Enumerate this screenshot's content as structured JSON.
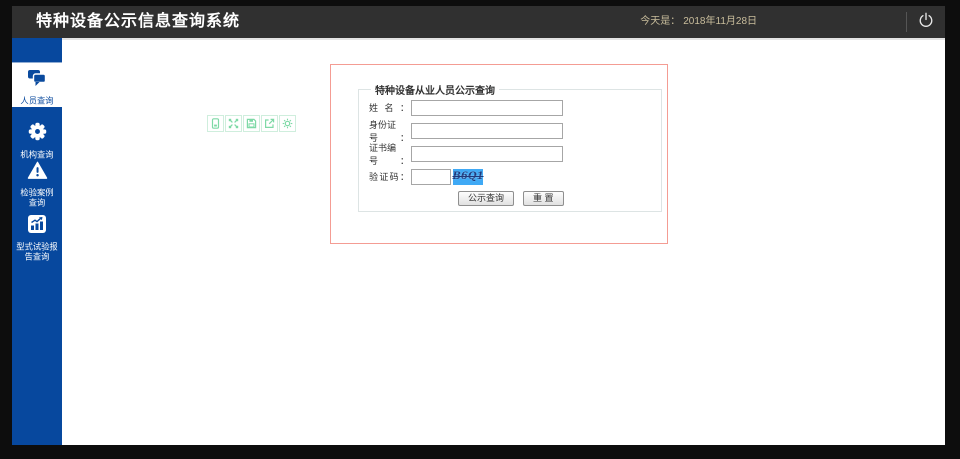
{
  "header": {
    "title": "特种设备公示信息查询系统",
    "date_label": "今天是：",
    "date_value": "2018年11月28日"
  },
  "sidebar": {
    "items": [
      {
        "line1": "人员查询",
        "line2": "",
        "icon": "chat-bubbles",
        "active": true
      },
      {
        "line1": "机构查询",
        "line2": "",
        "icon": "gear",
        "active": false
      },
      {
        "line1": "检验案例",
        "line2": "查询",
        "icon": "warning-triangle",
        "active": false
      },
      {
        "line1": "型式试验报",
        "line2": "告查询",
        "icon": "bar-chart",
        "active": false
      }
    ]
  },
  "toolbar": {
    "icons": [
      "mobile",
      "fullscreen",
      "save",
      "export",
      "settings"
    ]
  },
  "form": {
    "legend": "特种设备从业人员公示查询",
    "fields": [
      {
        "label": "姓名：",
        "value": ""
      },
      {
        "label": "身份证号：",
        "value": ""
      },
      {
        "label": "证书编号：",
        "value": ""
      }
    ],
    "captcha_label": "验证码：",
    "captcha_value": "",
    "captcha_code": "B6Q1",
    "submit_label": "公示查询",
    "reset_label": "重 置"
  },
  "colors": {
    "sidebar_blue": "#07489E",
    "header_bg": "#303030",
    "date_text": "#C9BD9C",
    "red_border": "#F49C93",
    "captcha_bg": "#3FA9F5",
    "toolbar_green": "#7ED9A6"
  }
}
